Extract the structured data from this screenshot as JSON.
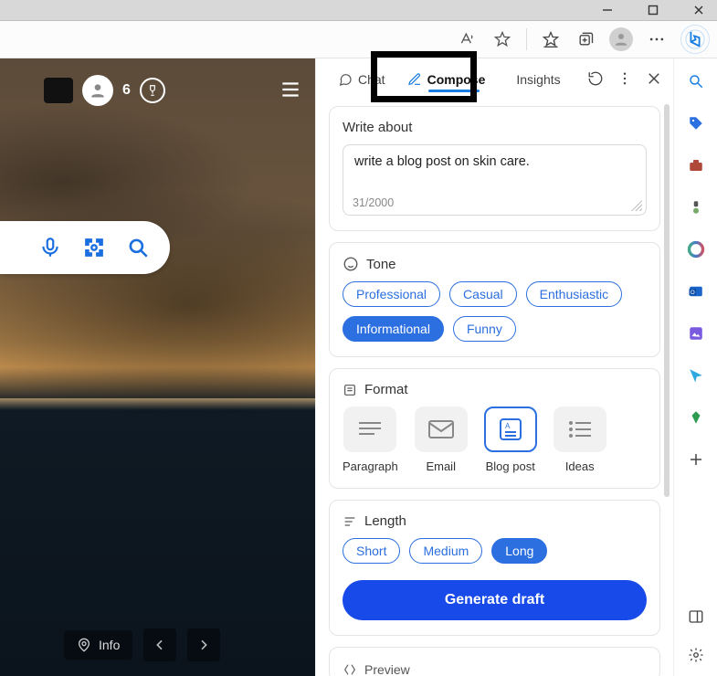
{
  "window": {
    "minimize": "–",
    "maximize": "❐",
    "close": "✕"
  },
  "left": {
    "score": "6",
    "info_label": "Info"
  },
  "panel": {
    "tabs": {
      "chat": "Chat",
      "compose": "Compose",
      "insights": "Insights"
    },
    "write_about_label": "Write about",
    "prompt_text": "write a blog post on skin care.",
    "prompt_count": "31/2000",
    "tone_label": "Tone",
    "tones": {
      "professional": "Professional",
      "casual": "Casual",
      "enthusiastic": "Enthusiastic",
      "informational": "Informational",
      "funny": "Funny"
    },
    "format_label": "Format",
    "formats": {
      "paragraph": "Paragraph",
      "email": "Email",
      "blog": "Blog post",
      "ideas": "Ideas"
    },
    "length_label": "Length",
    "lengths": {
      "short": "Short",
      "medium": "Medium",
      "long": "Long"
    },
    "generate": "Generate draft",
    "preview_label": "Preview"
  }
}
